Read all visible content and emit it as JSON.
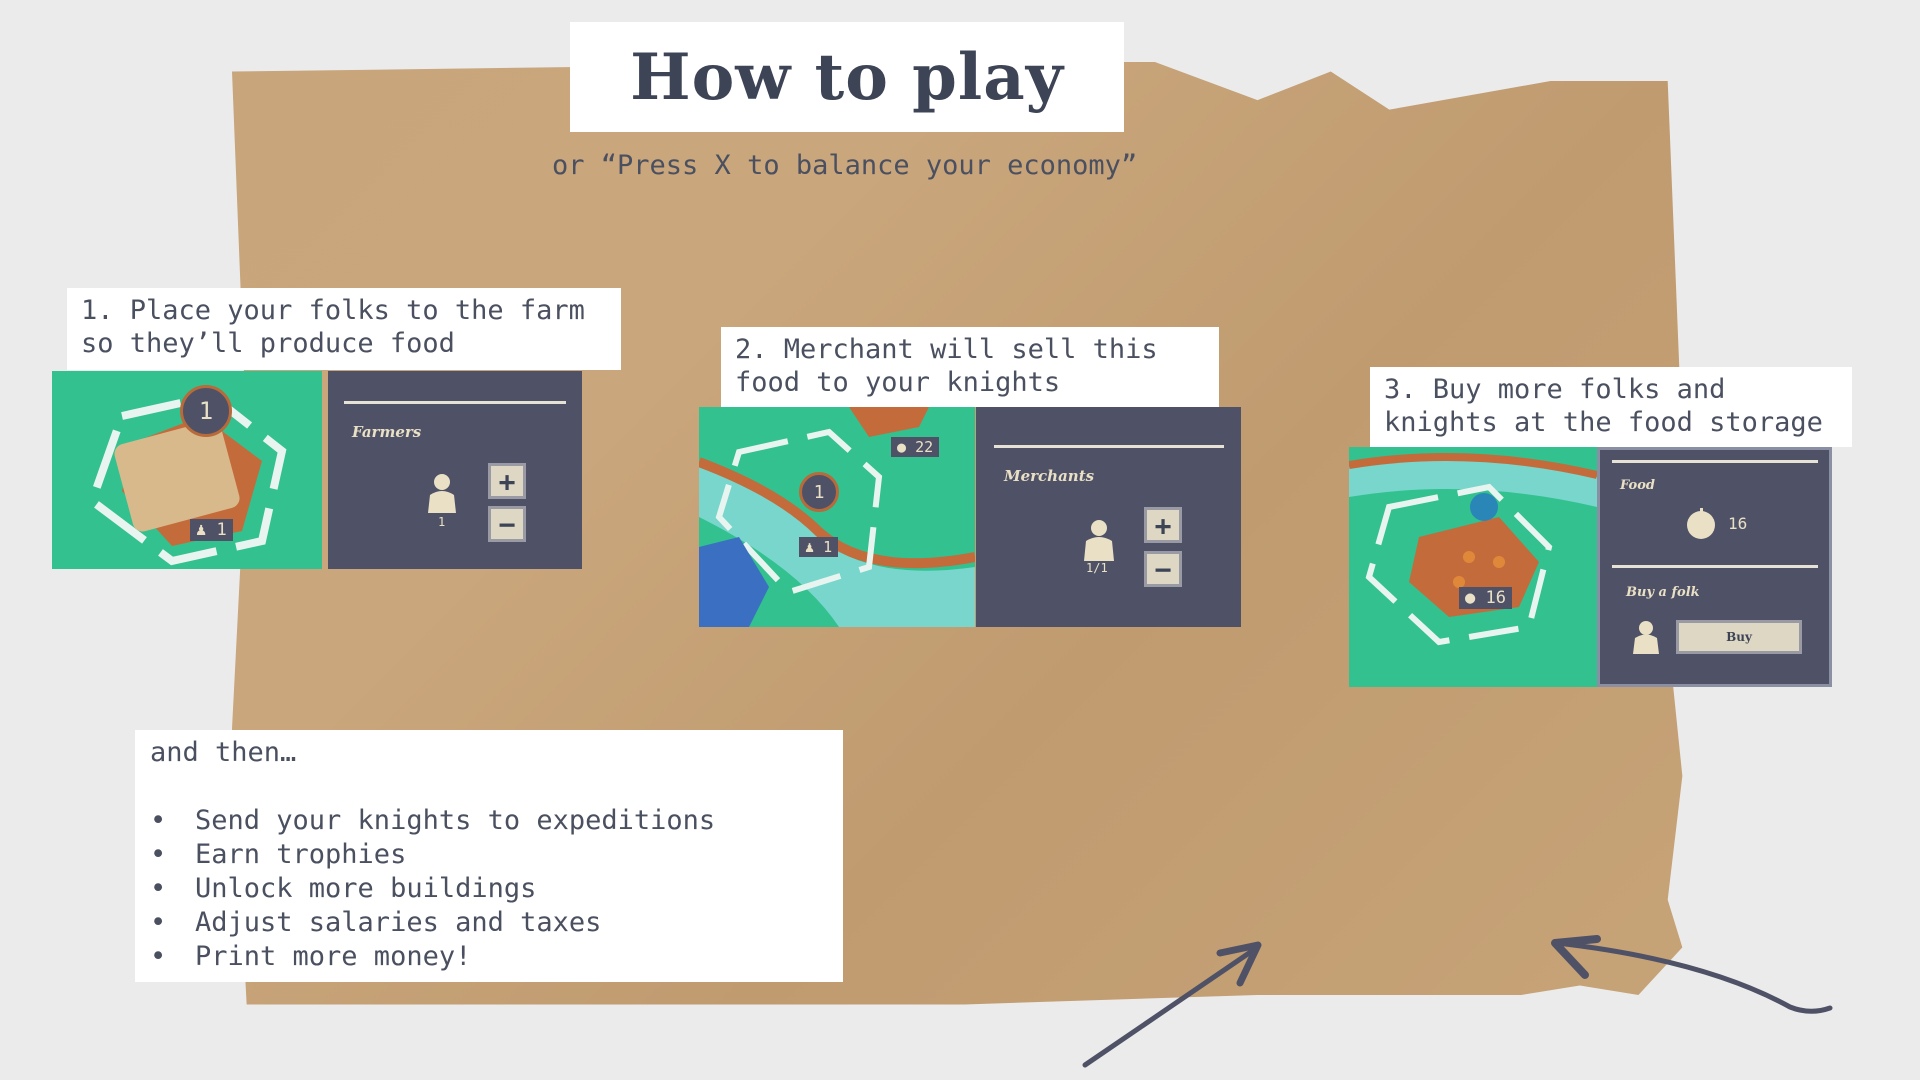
{
  "header": {
    "title": "How to play",
    "subtitle": "or “Press X to balance your economy”"
  },
  "steps": [
    {
      "text": "1. Place your folks to the farm\nso they’ll produce food",
      "panel_title": "Farmers",
      "count": "1",
      "hex_badge": "1",
      "tile_count": "1"
    },
    {
      "text": "2. Merchant will sell this\nfood to your knights",
      "panel_title": "Merchants",
      "count": "1/1",
      "hex_badge": "1",
      "tile_count": "1",
      "food_badge": "22"
    },
    {
      "text": "3. Buy more folks and\nknights at the food storage",
      "food_title": "Food",
      "food_count": "16",
      "buy_title": "Buy a folk",
      "buy_label": "Buy",
      "tile_count": "16"
    }
  ],
  "bottom": {
    "intro": "and then…",
    "items": [
      "Send your knights to expeditions",
      "Earn trophies",
      "Unlock more buildings",
      "Adjust salaries and taxes",
      "Print more money!"
    ]
  },
  "colors": {
    "panel": "#4f5266",
    "grass": "#32c18f",
    "text": "#4a5060",
    "paper": "#c8a57a"
  }
}
